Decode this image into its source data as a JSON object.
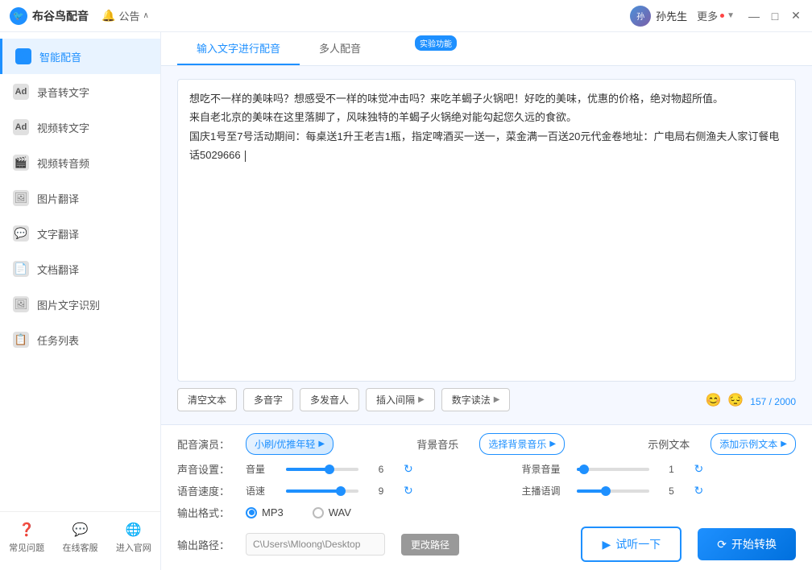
{
  "titlebar": {
    "logo_text": "🐦",
    "title": "布谷鸟配音",
    "notification_label": "公告",
    "notification_arrow": "∧",
    "user_name": "孙先生",
    "more_label": "更多",
    "min_btn": "—",
    "max_btn": "□",
    "close_btn": "✕"
  },
  "sidebar": {
    "items": [
      {
        "id": "smart-dub",
        "label": "智能配音",
        "active": true,
        "icon": "🎙"
      },
      {
        "id": "audio-text",
        "label": "录音转文字",
        "active": false,
        "icon": "🅐"
      },
      {
        "id": "video-text",
        "label": "视频转文字",
        "active": false,
        "icon": "🅐"
      },
      {
        "id": "video-audio",
        "label": "视频转音频",
        "active": false,
        "icon": "🎬"
      },
      {
        "id": "img-translate",
        "label": "图片翻译",
        "active": false,
        "icon": "🖼"
      },
      {
        "id": "text-translate",
        "label": "文字翻译",
        "active": false,
        "icon": "💬"
      },
      {
        "id": "doc-translate",
        "label": "文档翻译",
        "active": false,
        "icon": "📄"
      },
      {
        "id": "img-ocr",
        "label": "图片文字识别",
        "active": false,
        "icon": "🖼"
      },
      {
        "id": "task-list",
        "label": "任务列表",
        "active": false,
        "icon": "📋"
      }
    ],
    "bottom_items": [
      {
        "id": "faq",
        "label": "常见问题",
        "icon": "❓"
      },
      {
        "id": "support",
        "label": "在线客服",
        "icon": "💬"
      },
      {
        "id": "official",
        "label": "进入官网",
        "icon": "🌐"
      }
    ]
  },
  "tabs": {
    "items": [
      {
        "id": "input-text",
        "label": "输入文字进行配音",
        "active": true
      },
      {
        "id": "multi-voice",
        "label": "多人配音",
        "active": false
      }
    ],
    "experimental_badge": "实验功能"
  },
  "editor": {
    "content": "想吃不一样的美味吗？想感受不一样的味觉冲击吗？来吃羊蝎子火锅吧！好吃的美味，优惠的价格，绝对物超所值。\n来自老北京的美味在这里落脚了，风味独特的羊蝎子火锅绝对能勾起您久远的食欲。\n国庆1号至7号活动期间：每桌送1升王老吉1瓶，指定啤酒买一送一，菜金满一百送20元代金卷地址：广电局右侧渔夫人家订餐电话5029666",
    "char_count": "157 / 2000"
  },
  "toolbar": {
    "clear_btn": "清空文本",
    "poly_btn": "多音字",
    "multi_voice_btn": "多发音人",
    "insert_btn": "插入间隔",
    "insert_arrow": "▶",
    "digit_btn": "数字读法",
    "digit_arrow": "▶",
    "emoji1": "😊",
    "emoji2": "😔"
  },
  "settings": {
    "voice_label": "配音演员：",
    "voice_value": "小刷/优推年轻",
    "voice_arrow": "▶",
    "bg_music_label": "背景音乐",
    "bg_music_value": "选择背景音乐",
    "bg_music_arrow": "▶",
    "example_label": "示例文本",
    "example_value": "添加示例文本",
    "example_arrow": "▶",
    "voice_settings_label": "声音设置：",
    "volume_label": "音量",
    "volume_value": "6",
    "bg_volume_label": "背景音量",
    "bg_volume_value": "1",
    "speed_label": "语音速度：",
    "speed_sublabel": "语速",
    "speed_value": "9",
    "anchor_label": "主播语调",
    "anchor_value": "5",
    "format_label": "输出格式：",
    "format_mp3": "MP3",
    "format_wav": "WAV",
    "path_label": "输出路径：",
    "path_value": "C\\Users\\Mloong\\Desktop",
    "change_path_btn": "更改路径",
    "preview_btn": "试听一下",
    "convert_btn": "开始转换",
    "slider_volume_fill_pct": "60",
    "slider_speed_fill_pct": "75"
  }
}
